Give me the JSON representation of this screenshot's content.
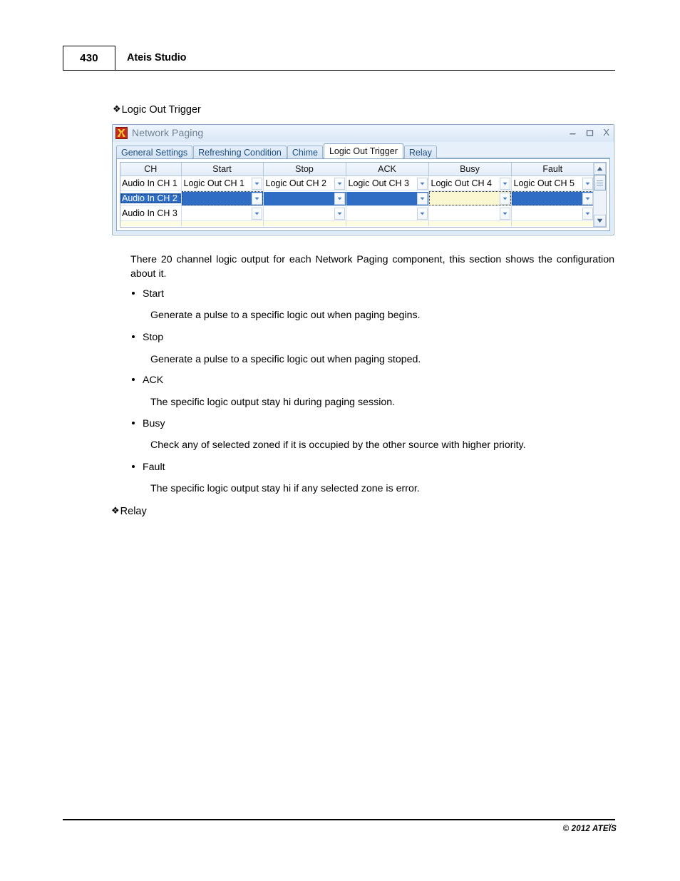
{
  "page": {
    "number": "430",
    "header_title": "Ateis Studio",
    "footer_copyright": "© 2012 ATEÏS"
  },
  "headings": {
    "logic_out_trigger": "Logic Out Trigger",
    "relay": "Relay",
    "diamond_glyph": "❖"
  },
  "app_window": {
    "title": "Network Paging",
    "icon": "ateis-app-icon",
    "controls": {
      "minimize": "minimize-icon",
      "maximize": "maximize-icon",
      "close": "X"
    },
    "tabs": [
      {
        "label": "General Settings",
        "active": false
      },
      {
        "label": "Refreshing Condition",
        "active": false
      },
      {
        "label": "Chime",
        "active": false
      },
      {
        "label": "Logic Out Trigger",
        "active": true
      },
      {
        "label": "Relay",
        "active": false
      }
    ],
    "grid": {
      "columns": [
        "CH",
        "Start",
        "Stop",
        "ACK",
        "Busy",
        "Fault"
      ],
      "rows": [
        {
          "ch": "Audio In CH 1",
          "ch_selected": false,
          "cells": [
            {
              "value": "Logic Out CH 1",
              "state": "normal"
            },
            {
              "value": "Logic Out CH 2",
              "state": "normal"
            },
            {
              "value": "Logic Out CH 3",
              "state": "normal"
            },
            {
              "value": "Logic Out CH 4",
              "state": "normal"
            },
            {
              "value": "Logic Out CH 5",
              "state": "normal"
            }
          ]
        },
        {
          "ch": "Audio In CH 2",
          "ch_selected": true,
          "cells": [
            {
              "value": "",
              "state": "selected"
            },
            {
              "value": "",
              "state": "selected"
            },
            {
              "value": "",
              "state": "selected"
            },
            {
              "value": "",
              "state": "focused"
            },
            {
              "value": "",
              "state": "selected"
            }
          ]
        },
        {
          "ch": "Audio In CH 3",
          "ch_selected": false,
          "cells": [
            {
              "value": "",
              "state": "normal"
            },
            {
              "value": "",
              "state": "normal"
            },
            {
              "value": "",
              "state": "normal"
            },
            {
              "value": "",
              "state": "normal"
            },
            {
              "value": "",
              "state": "normal"
            }
          ]
        }
      ],
      "scrollbar": {
        "up": "scroll-up-icon",
        "down": "scroll-down-icon",
        "thumb": "scroll-thumb"
      }
    },
    "colors": {
      "selection_blue": "#2f6cc4",
      "focus_cream": "#fbf7d0",
      "frame_blue": "#8aa9c8",
      "icon_red": "#b71c12"
    }
  },
  "body": {
    "intro": "There 20 channel logic output for each Network Paging component, this section shows the configuration about it.",
    "bullets": [
      {
        "label": "Start",
        "description": "Generate a pulse to a specific logic out when paging begins."
      },
      {
        "label": "Stop",
        "description": "Generate a pulse to a specific logic out when paging stoped."
      },
      {
        "label": "ACK",
        "description": "The specific logic output stay hi during paging session."
      },
      {
        "label": "Busy",
        "description": "Check any of selected zoned if it is occupied by the other source with higher priority."
      },
      {
        "label": "Fault",
        "description": "The specific logic output stay hi if any selected zone is error."
      }
    ]
  }
}
